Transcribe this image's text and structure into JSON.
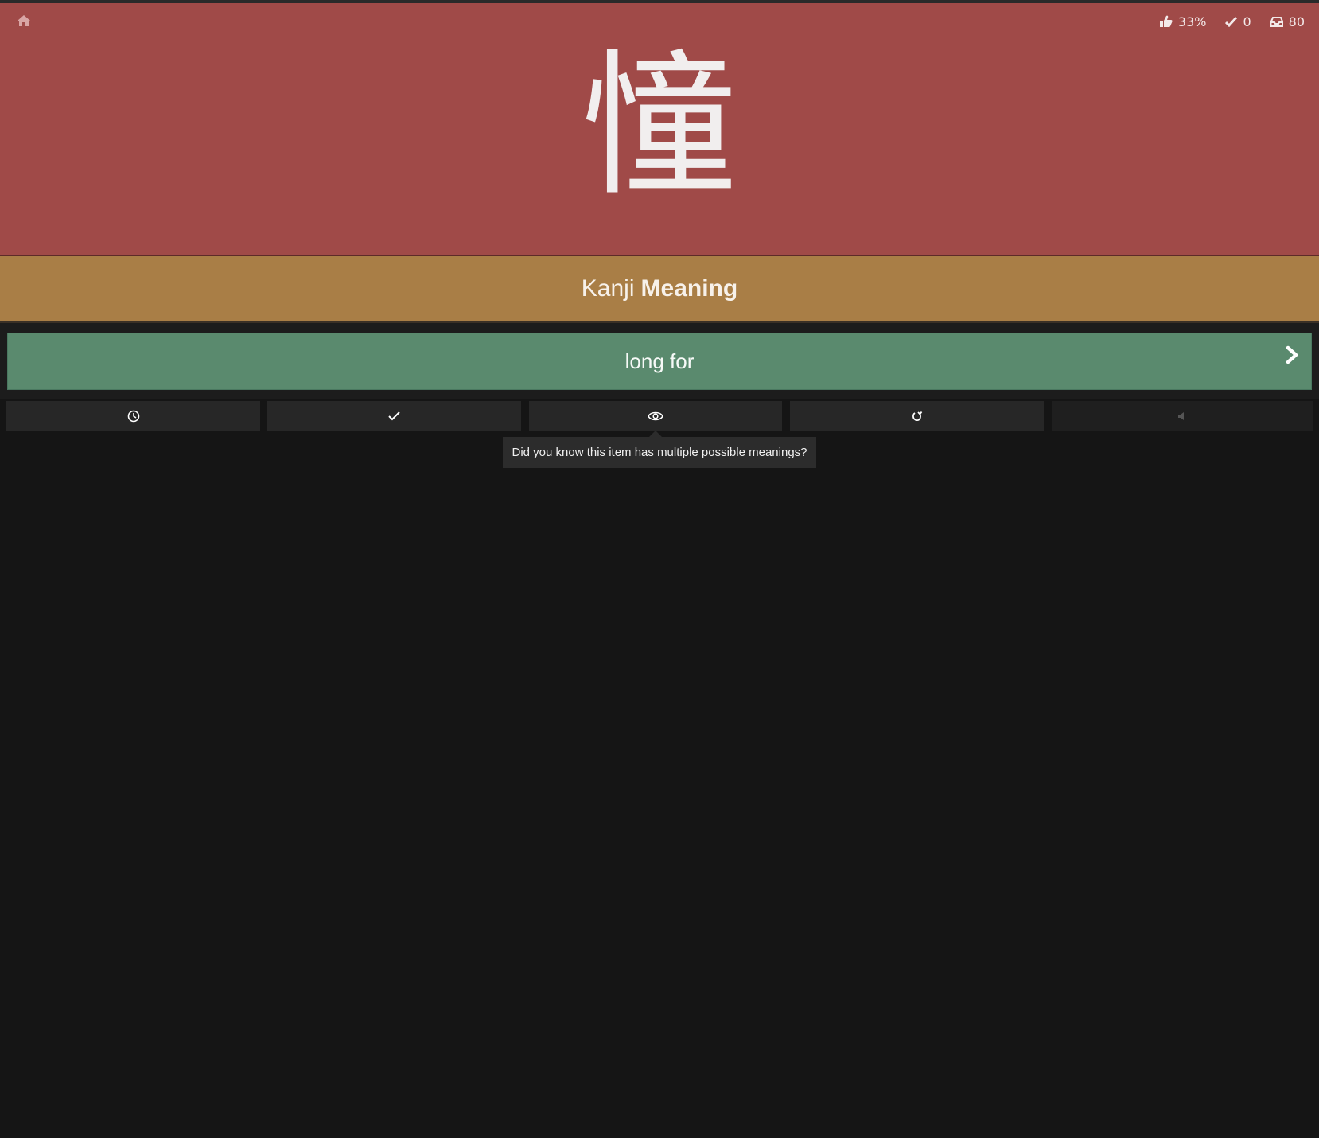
{
  "header": {
    "stats": {
      "accuracy": "33%",
      "completed": "0",
      "remaining": "80"
    },
    "kanji": "憧"
  },
  "prompt": {
    "type": "Kanji",
    "category": "Meaning"
  },
  "answer": {
    "value": "long for"
  },
  "toolbar": {
    "buttons": [
      "clock-icon",
      "check-icon",
      "eye-icon",
      "undo-icon",
      "speaker-icon"
    ]
  },
  "tooltip": {
    "text": "Did you know this item has multiple possible meanings?"
  },
  "colors": {
    "header_bg": "#a04a48",
    "prompt_bg": "#a97e46",
    "answer_bg": "#5a8a6e",
    "page_bg": "#151515"
  }
}
